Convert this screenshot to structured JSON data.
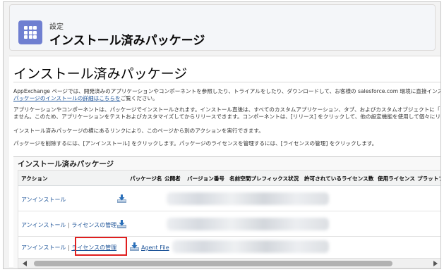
{
  "header": {
    "subtitle": "設定",
    "title": "インストール済みパッケージ"
  },
  "page": {
    "title": "インストール済みパッケージ",
    "paragraphs": [
      {
        "lines": [
          "AppExchange ページでは、開発済みのアプリケーションやコンポーネントを参照したり、トライアルをしたり、ダウンロードして、お客様の salesforce.com 環境に直接インスト"
        ],
        "link": "パッケージのインストールの詳細はこちらを",
        "link_suffix": "ご覧ください。"
      },
      {
        "lines": [
          "アプリケーションやコンポーネントは、パッケージでインストールされます。インストール直後は、すべてのカスタムアプリケーション、タブ、およびカスタムオブジェクトに「開発中」のマ",
          "ません。このため、アプリケーションをテストおよびカスタマイズしてからリリースできます。コンポーネントは、[リリース] をクリックして、他の設定機能を使用して個々にリリースした"
        ]
      },
      {
        "lines": [
          "インストール済みパッケージの横にあるリンクにより、このページから別のアクションを実行できます。"
        ]
      },
      {
        "lines": [
          "パッケージを削除するには、[アンインストール] をクリックします。パッケージのライセンスを管理するには、[ライセンスの管理] をクリックします。"
        ]
      }
    ]
  },
  "section": {
    "title": "インストール済みパッケージ",
    "columns": [
      "アクション",
      "パッケージ名",
      "公開者",
      "バージョン番号",
      "名前空間プレフィックス",
      "状況",
      "許可されているライセンス数",
      "使用ライセンス",
      "プラットフォー"
    ],
    "rows": [
      {
        "uninstall": "アンインストール",
        "sep": "",
        "manage": "",
        "package_name": ""
      },
      {
        "uninstall": "アンインストール",
        "sep": " | ",
        "manage": "ライセンスの管理",
        "package_name": ""
      },
      {
        "uninstall": "アンインストール",
        "sep": " | ",
        "manage": "ライセンスの管理",
        "package_name": "Agent File"
      }
    ]
  },
  "icons": {
    "app": "app-launcher-grid-icon",
    "download": "download-icon",
    "scroll_left": "scroll-left-arrow-icon",
    "scroll_right": "scroll-right-arrow-icon"
  },
  "colors": {
    "app_tile": "#6f7fd1",
    "link": "#1b5297",
    "highlight": "#e01e1e"
  }
}
